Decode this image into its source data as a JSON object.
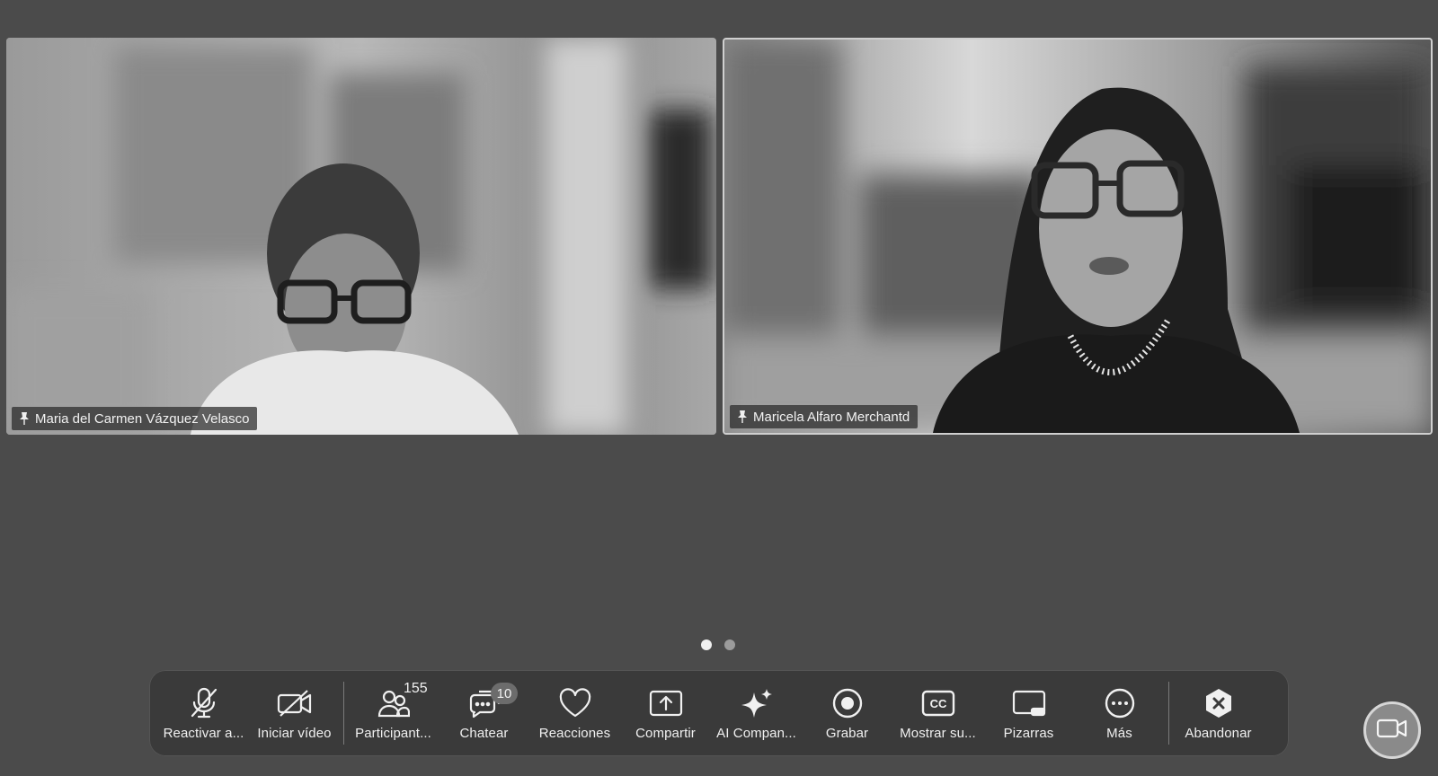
{
  "participants": [
    {
      "name": "Maria del Carmen Vázquez Velasco"
    },
    {
      "name": "Maricela Alfaro Merchantd"
    }
  ],
  "pager": {
    "pages": 2,
    "active": 1
  },
  "toolbar": {
    "unmute_label": "Reactivar a...",
    "video_label": "Iniciar vídeo",
    "participants_label": "Participant...",
    "participants_count": "155",
    "chat_label": "Chatear",
    "chat_badge": "10",
    "reactions_label": "Reacciones",
    "share_label": "Compartir",
    "ai_label": "AI Compan...",
    "record_label": "Grabar",
    "captions_label": "Mostrar su...",
    "whiteboard_label": "Pizarras",
    "more_label": "Más",
    "leave_label": "Abandonar"
  },
  "icons": [
    "mic-muted-icon",
    "video-off-icon",
    "participants-icon",
    "chat-icon",
    "heart-icon",
    "share-screen-icon",
    "sparkle-icon",
    "record-icon",
    "cc-icon",
    "whiteboard-icon",
    "more-icon",
    "leave-icon",
    "pin-icon",
    "camera-icon"
  ]
}
